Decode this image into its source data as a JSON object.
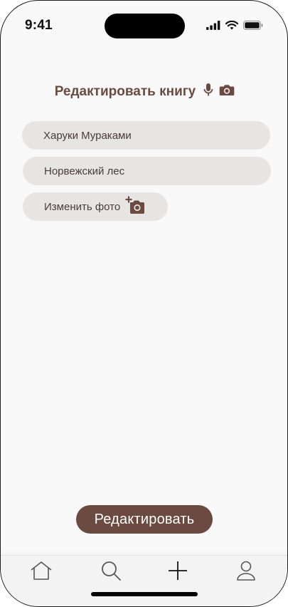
{
  "status_bar": {
    "time": "9:41"
  },
  "header": {
    "title": "Редактировать книгу",
    "icons": [
      "microphone-icon",
      "camera-icon"
    ]
  },
  "form": {
    "author_value": "Харуки Мураками",
    "title_value": "Норвежский лес",
    "photo_label": "Изменить фото"
  },
  "actions": {
    "submit_label": "Редактировать"
  },
  "tabbar": {
    "items": [
      "home-icon",
      "search-icon",
      "plus-icon",
      "profile-icon"
    ]
  },
  "colors": {
    "accent": "#6b4a40",
    "field_bg": "#e6e5e4",
    "screen_bg": "#f9f9f9"
  }
}
